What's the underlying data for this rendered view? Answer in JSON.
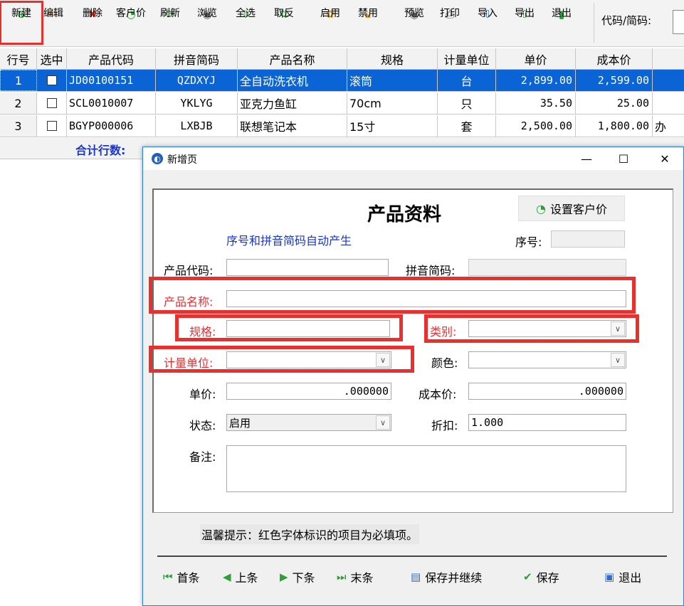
{
  "toolbar": {
    "buttons": [
      {
        "label": "新建",
        "icon": "plus-circle-icon",
        "color": "#2e9e3a"
      },
      {
        "label": "编辑",
        "icon": "edit-icon",
        "color": "#c78a2a"
      },
      {
        "label": "删除",
        "icon": "delete-x-icon",
        "color": "#d63020"
      },
      {
        "label": "客户价",
        "icon": "customer-price-icon",
        "color": "#2e9e3a"
      },
      {
        "label": "刷新",
        "icon": "refresh-icon",
        "color": "#2e9e3a"
      },
      {
        "label": "浏览",
        "icon": "eye-icon",
        "color": "#555555"
      },
      {
        "label": "全选",
        "icon": "select-all-icon",
        "color": "#2e9e3a"
      },
      {
        "label": "取反",
        "icon": "invert-icon",
        "color": "#2e9e3a"
      },
      {
        "label": "启用",
        "icon": "enable-icon",
        "color": "#e0a020"
      },
      {
        "label": "禁用",
        "icon": "disable-lock-icon",
        "color": "#e0a020"
      },
      {
        "label": "预览",
        "icon": "preview-eye-icon",
        "color": "#555555"
      },
      {
        "label": "打印",
        "icon": "printer-icon",
        "color": "#555555"
      },
      {
        "label": "导入",
        "icon": "import-icon",
        "color": "#2a6fd0"
      },
      {
        "label": "导出",
        "icon": "export-icon",
        "color": "#2e9e3a"
      },
      {
        "label": "退出",
        "icon": "exit-door-icon",
        "color": "#2e9e3a"
      }
    ],
    "code_label": "代码/简码:"
  },
  "grid": {
    "headers": [
      "行号",
      "选中",
      "产品代码",
      "拼音简码",
      "产品名称",
      "规格",
      "计量单位",
      "单价",
      "成本价"
    ],
    "rows": [
      {
        "num": "1",
        "code": "JD00100151",
        "py": "QZDXYJ",
        "name": "全自动洗衣机",
        "spec": "滚筒",
        "unit": "台",
        "price": "2,899.00",
        "cost": "2,599.00",
        "extra": ""
      },
      {
        "num": "2",
        "code": "SCL0010007",
        "py": "YKLYG",
        "name": "亚克力鱼缸",
        "spec": "70cm",
        "unit": "只",
        "price": "35.50",
        "cost": "25.00",
        "extra": ""
      },
      {
        "num": "3",
        "code": "BGYP000006",
        "py": "LXBJB",
        "name": "联想笔记本",
        "spec": "15寸",
        "unit": "套",
        "price": "2,500.00",
        "cost": "1,800.00",
        "extra": "办"
      }
    ],
    "summary_label": "合计行数:"
  },
  "dialog": {
    "title": "新增页",
    "form_title": "产品资料",
    "set_price_label": "设置客户价",
    "hint": "序号和拼音简码自动产生",
    "fields": {
      "seq": {
        "label": "序号:",
        "value": ""
      },
      "code": {
        "label": "产品代码:",
        "value": ""
      },
      "pinyin": {
        "label": "拼音简码:",
        "value": ""
      },
      "name": {
        "label": "产品名称:",
        "value": ""
      },
      "spec": {
        "label": "规格:",
        "value": ""
      },
      "category": {
        "label": "类别:",
        "value": ""
      },
      "unit": {
        "label": "计量单位:",
        "value": ""
      },
      "color": {
        "label": "颜色:",
        "value": ""
      },
      "price": {
        "label": "单价:",
        "value": ".000000"
      },
      "cost": {
        "label": "成本价:",
        "value": ".000000"
      },
      "status": {
        "label": "状态:",
        "value": "启用"
      },
      "discount": {
        "label": "折扣:",
        "value": "1.000"
      },
      "remark": {
        "label": "备注:",
        "value": ""
      }
    },
    "notice": "温馨提示：红色字体标识的项目为必填项。",
    "footer": {
      "first": "首条",
      "prev": "上条",
      "next": "下条",
      "last": "末条",
      "save_continue": "保存并继续",
      "save": "保存",
      "exit": "退出"
    }
  },
  "colors": {
    "required": "#e8302f",
    "hint_blue": "#1a35c8",
    "selection": "#0a64d6"
  }
}
